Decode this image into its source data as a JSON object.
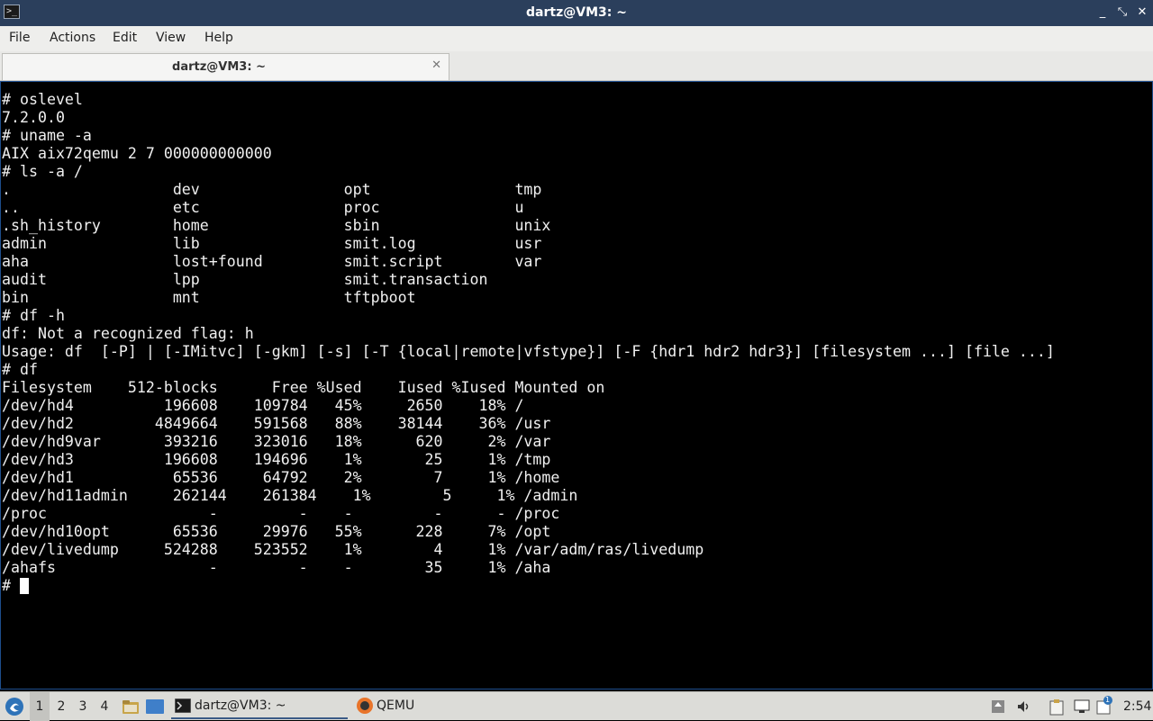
{
  "window": {
    "title": "dartz@VM3: ~",
    "app_icon_glyph": ">_",
    "controls": {
      "minimize": "_",
      "restore": "⤡",
      "close": "✕"
    }
  },
  "menu": {
    "items": [
      "File",
      "Actions",
      "Edit",
      "View",
      "Help"
    ]
  },
  "tabs": [
    {
      "label": "dartz@VM3: ~",
      "close": "✕"
    }
  ],
  "terminal": {
    "lines": [
      "# oslevel",
      "7.2.0.0",
      "# uname -a",
      "AIX aix72qemu 2 7 000000000000",
      "# ls -a /",
      ".                  dev                opt                tmp",
      "..                 etc                proc               u",
      ".sh_history        home               sbin               unix",
      "admin              lib                smit.log           usr",
      "aha                lost+found         smit.script        var",
      "audit              lpp                smit.transaction",
      "bin                mnt                tftpboot",
      "# df -h",
      "df: Not a recognized flag: h",
      "Usage: df  [-P] | [-IMitvc] [-gkm] [-s] [-T {local|remote|vfstype}] [-F {hdr1 hdr2 hdr3}] [filesystem ...] [file ...]",
      "# df",
      "Filesystem    512-blocks      Free %Used    Iused %Iused Mounted on",
      "/dev/hd4          196608    109784   45%     2650    18% /",
      "/dev/hd2         4849664    591568   88%    38144    36% /usr",
      "/dev/hd9var       393216    323016   18%      620     2% /var",
      "/dev/hd3          196608    194696    1%       25     1% /tmp",
      "/dev/hd1           65536     64792    2%        7     1% /home",
      "/dev/hd11admin     262144    261384    1%        5     1% /admin",
      "/proc                  -         -    -         -      - /proc",
      "/dev/hd10opt       65536     29976   55%      228     7% /opt",
      "/dev/livedump     524288    523552    1%        4     1% /var/adm/ras/livedump",
      "/ahafs                 -         -    -        35     1% /aha",
      "# "
    ]
  },
  "taskbar": {
    "workspaces": [
      "1",
      "2",
      "3",
      "4"
    ],
    "active_workspace": "1",
    "tasks": [
      {
        "label": "dartz@VM3: ~"
      },
      {
        "label": "QEMU"
      }
    ],
    "clock": "2:54",
    "notification_badge": "1"
  },
  "colors": {
    "titlebar": "#2b3f5c",
    "terminal_bg": "#000000",
    "terminal_fg": "#f0f0f0",
    "terminal_border": "#1e4d8c",
    "taskbar": "#dcdcd8"
  }
}
